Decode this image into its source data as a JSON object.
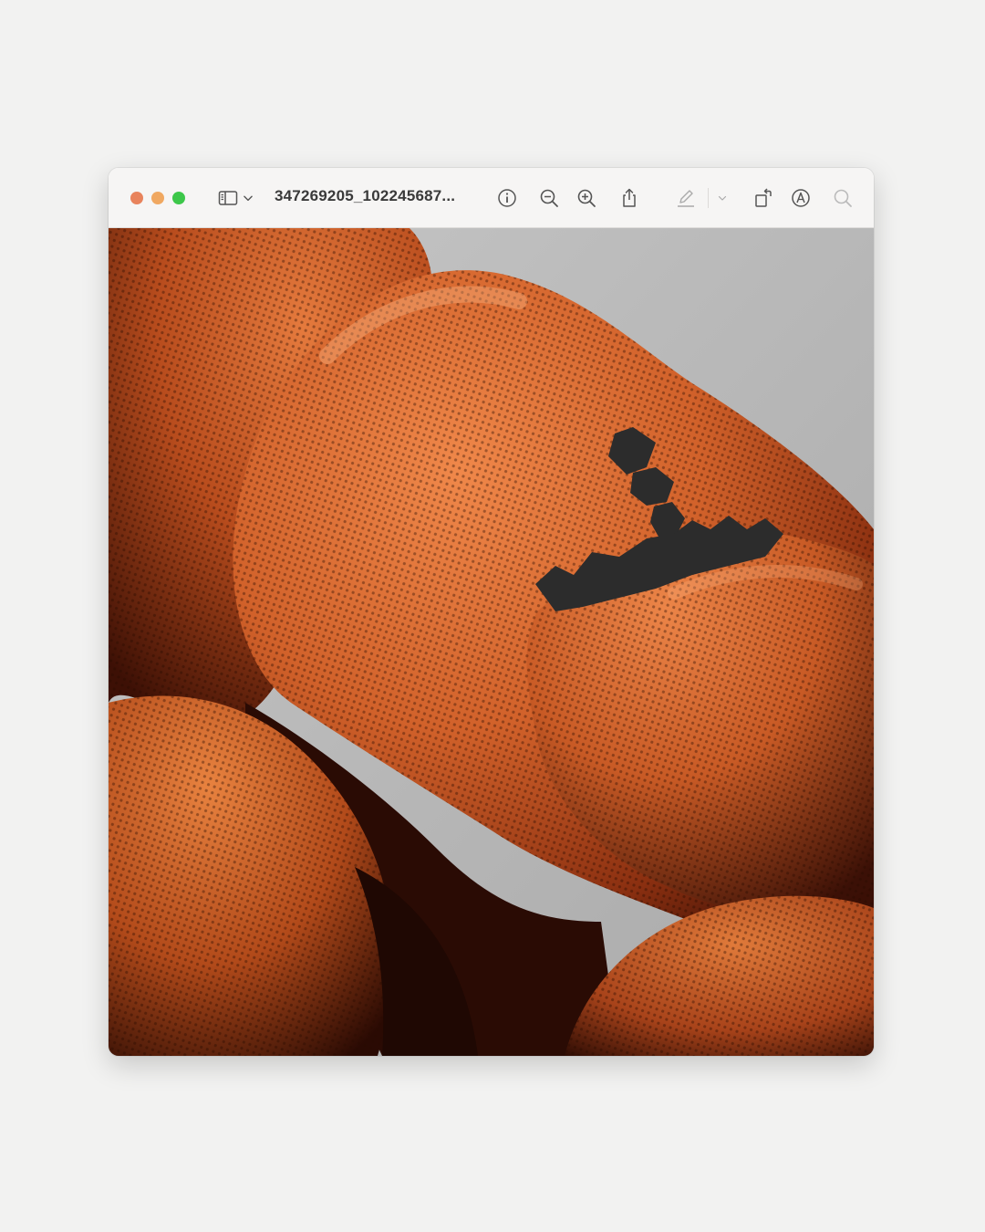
{
  "window": {
    "title": "347269205_102245687..."
  },
  "toolbar": {
    "buttons": [
      {
        "name": "sidebar-toggle",
        "icon": "sidebar-icon"
      },
      {
        "name": "sidebar-menu",
        "icon": "chevron-down-icon"
      },
      {
        "name": "info",
        "icon": "info-icon"
      },
      {
        "name": "zoom-out",
        "icon": "zoom-out-icon"
      },
      {
        "name": "zoom-in",
        "icon": "zoom-in-icon"
      },
      {
        "name": "share",
        "icon": "share-icon"
      },
      {
        "name": "highlight",
        "icon": "pencil-highlight-icon"
      },
      {
        "name": "highlight-menu",
        "icon": "chevron-down-icon"
      },
      {
        "name": "rotate",
        "icon": "rotate-icon"
      },
      {
        "name": "markup",
        "icon": "markup-pen-icon"
      },
      {
        "name": "search",
        "icon": "search-icon"
      }
    ]
  },
  "traffic_lights": {
    "close": "#e8835c",
    "minimize": "#f0a861",
    "zoom": "#3dc74a"
  },
  "image": {
    "background": "#b7b7b7",
    "accent": "#d9672a",
    "shadow": "#3a0f05"
  }
}
